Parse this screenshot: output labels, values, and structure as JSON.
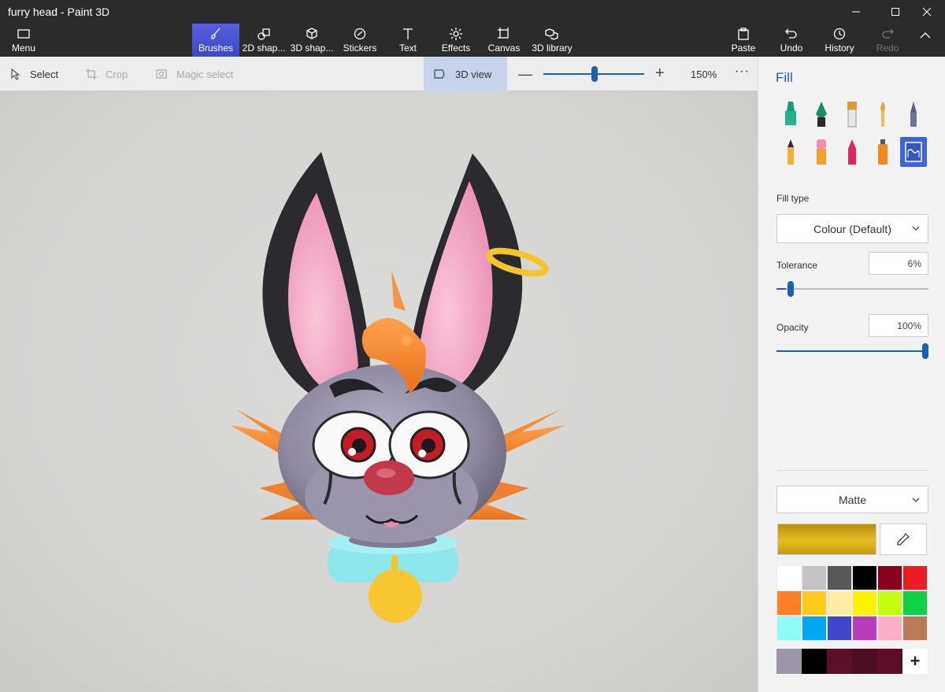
{
  "window": {
    "title": "furry head - Paint 3D"
  },
  "toolbar": {
    "menu_label": "Menu",
    "brushes_label": "Brushes",
    "shapes2d_label": "2D shap...",
    "shapes3d_label": "3D shap...",
    "stickers_label": "Stickers",
    "text_label": "Text",
    "effects_label": "Effects",
    "canvas_label": "Canvas",
    "library_label": "3D library",
    "paste_label": "Paste",
    "undo_label": "Undo",
    "history_label": "History",
    "redo_label": "Redo"
  },
  "subbar": {
    "select_label": "Select",
    "crop_label": "Crop",
    "magic_label": "Magic select",
    "view3d_label": "3D view",
    "zoom_value": "150%",
    "zoom_level": 0.5,
    "more_label": "···"
  },
  "panel": {
    "title": "Fill",
    "fill_type_label": "Fill type",
    "fill_type_value": "Colour (Default)",
    "tolerance_label": "Tolerance",
    "tolerance_value": "6%",
    "tolerance_level": 0.06,
    "opacity_label": "Opacity",
    "opacity_value": "100%",
    "opacity_level": 1.0,
    "finish_value": "Matte",
    "current_color": "#e3bd22",
    "palette": [
      "#ffffff",
      "#c3c3c3",
      "#585858",
      "#000000",
      "#88001b",
      "#ec1c24",
      "#ff7f27",
      "#ffca18",
      "#fdeca6",
      "#fff200",
      "#c4ff0e",
      "#0ed145",
      "#8cfffb",
      "#00a8f3",
      "#3f48cc",
      "#b83dba",
      "#ffaec8",
      "#b97a56"
    ],
    "custom_colors": [
      "#9c96a6",
      "#000000",
      "#5a0f2b",
      "#4d0d24",
      "#5e0d29"
    ],
    "add_label": "+"
  }
}
